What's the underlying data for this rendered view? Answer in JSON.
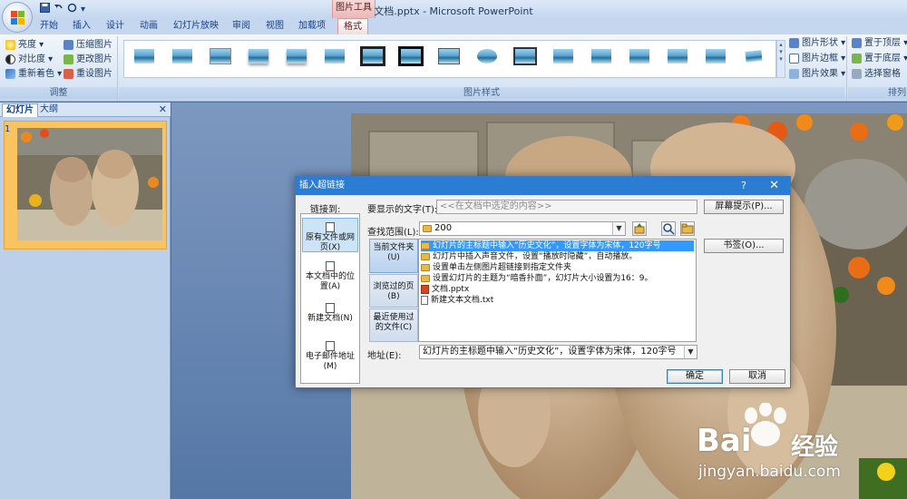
{
  "window": {
    "title": "文档.pptx - Microsoft PowerPoint",
    "context_tab_group": "图片工具",
    "qat_glyphs": [
      "▾"
    ]
  },
  "ribbon": {
    "tabs": [
      "开始",
      "插入",
      "设计",
      "动画",
      "幻灯片放映",
      "审阅",
      "视图",
      "加载项",
      "格式"
    ],
    "active_tab": "格式",
    "adjust_group": {
      "label": "调整",
      "items": [
        "亮度 ▾",
        "对比度 ▾",
        "重新着色 ▾",
        "压缩图片",
        "更改图片",
        "重设图片"
      ]
    },
    "styles_group": {
      "label": "图片样式"
    },
    "picture_group": {
      "items": [
        "图片形状 ▾",
        "图片边框 ▾",
        "图片效果 ▾"
      ]
    },
    "arrange_group": {
      "label": "排列",
      "items": [
        "置于顶层 ▾",
        "置于底层 ▾",
        "选择窗格"
      ]
    }
  },
  "left_pane": {
    "tabs": [
      "幻灯片",
      "大纲"
    ],
    "close": "✕",
    "slide_number": "1"
  },
  "dialog": {
    "title": "插入超链接",
    "help": "?",
    "close": "✕",
    "link_to_label": "链接到:",
    "link_targets": [
      "原有文件或网页(X)",
      "本文档中的位置(A)",
      "新建文档(N)",
      "电子邮件地址(M)"
    ],
    "display_text_label": "要显示的文字(T):",
    "display_text_value": "<<在文档中选定的内容>>",
    "screen_tip_button": "屏幕提示(P)...",
    "look_in_label": "查找范围(L):",
    "look_in_value": "200",
    "nav_items": [
      "当前文件夹(U)",
      "浏览过的页(B)",
      "最近使用过的文件(C)"
    ],
    "files": [
      "幻灯片的主标题中输入“历史文化”，设置字体为宋体，120字号",
      "幻灯片中插入声音文件，设置“播放时隐藏”，自动播放。",
      "设置单击左侧图片超链接到指定文件夹",
      "设置幻灯片的主题为“暗香扑面”，幻灯片大小设置为16：9。",
      "文档.pptx",
      "新建文本文档.txt"
    ],
    "bookmark_button": "书签(O)...",
    "address_label": "地址(E):",
    "address_value": "幻灯片的主标题中输入“历史文化”，设置字体为宋体，120字号",
    "ok_button": "确定",
    "cancel_button": "取消"
  },
  "watermark": {
    "brand": "Bai",
    "brand_cn": "经验",
    "url": "jingyan.baidu.com"
  }
}
